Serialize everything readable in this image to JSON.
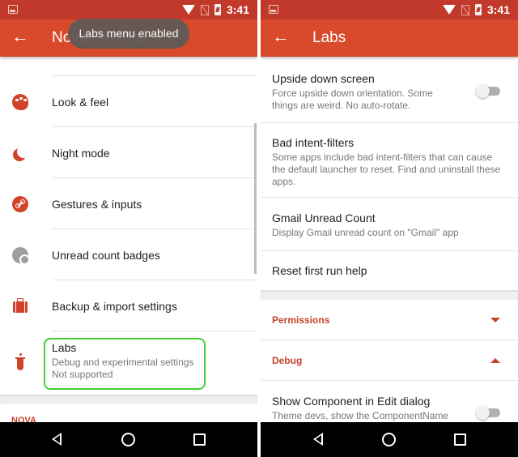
{
  "status_bar": {
    "time": "3:41",
    "icons": [
      "image-notification-icon",
      "wifi-icon",
      "no-sim-icon",
      "battery-charging-icon"
    ]
  },
  "left": {
    "appbar": {
      "title": "Nova Settings",
      "back_icon": "arrow-back-icon"
    },
    "toast": "Labs menu enabled",
    "items": [
      {
        "label": "Look & feel",
        "icon": "palette-icon"
      },
      {
        "label": "Night mode",
        "icon": "moon-icon"
      },
      {
        "label": "Gestures & inputs",
        "icon": "gesture-icon"
      },
      {
        "label": "Unread count badges",
        "icon": "badge-icon"
      },
      {
        "label": "Backup & import settings",
        "icon": "briefcase-icon"
      }
    ],
    "labs": {
      "title": "Labs",
      "subtitle": "Debug and experimental settings",
      "note": "Not supported",
      "icon": "test-tube-icon",
      "highlight_color": "#3fcf3a"
    },
    "section_header": "NOVA"
  },
  "right": {
    "appbar": {
      "title": "Labs",
      "back_icon": "arrow-back-icon"
    },
    "items": [
      {
        "title": "Upside down screen",
        "subtitle": "Force upside down orientation. Some things are weird. No auto-rotate.",
        "toggle": false
      },
      {
        "title": "Bad intent-filters",
        "subtitle": "Some apps include bad intent-filters that can cause the default launcher to reset. Find and uninstall these apps."
      },
      {
        "title": "Gmail Unread Count",
        "subtitle": "Display Gmail unread count on \"Gmail\" app"
      },
      {
        "title": "Reset first run help"
      }
    ],
    "sections": [
      {
        "title": "Permissions",
        "expanded": false
      },
      {
        "title": "Debug",
        "expanded": true
      }
    ],
    "debug_items": [
      {
        "title": "Show Component in Edit dialog",
        "subtitle": "Theme devs, show the ComponentName",
        "toggle": false
      }
    ]
  },
  "navbar": {
    "back": "nav-back-icon",
    "home": "nav-home-icon",
    "recents": "nav-recents-icon"
  },
  "colors": {
    "status_bar": "#c1392a",
    "app_bar": "#d84a2b",
    "accent": "#c6412a",
    "highlight": "#3fcf3a"
  }
}
